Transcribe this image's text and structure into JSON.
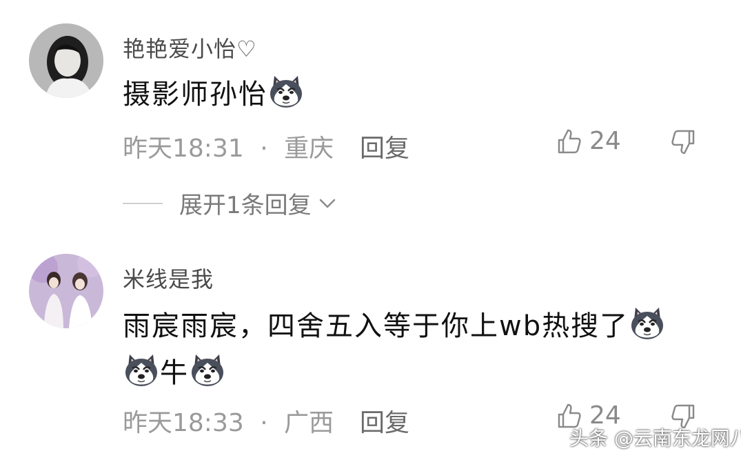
{
  "comments": [
    {
      "username": "艳艳爱小怡♡",
      "text_parts": [
        "摄影师孙怡"
      ],
      "time": "昨天18:31",
      "separator": "·",
      "location": "重庆",
      "reply_label": "回复",
      "likes": "24",
      "expand_replies": "展开1条回复"
    },
    {
      "username": "米线是我",
      "line1": "雨宸雨宸，四舍五入等于你上wb热搜了",
      "line2": "牛",
      "time": "昨天18:33",
      "separator": "·",
      "location": "广西",
      "reply_label": "回复",
      "likes": "24"
    }
  ],
  "watermark": "头条 @云南东龙网八",
  "icons": {
    "like": "thumbs-up-icon",
    "dislike": "thumbs-down-icon",
    "emoji": "husky-dog-emoji-icon",
    "expand": "chevron-down-icon"
  },
  "colors": {
    "meta_gray": "#9a9a9a",
    "username_gray": "#4a4a4a",
    "text": "#111111"
  }
}
